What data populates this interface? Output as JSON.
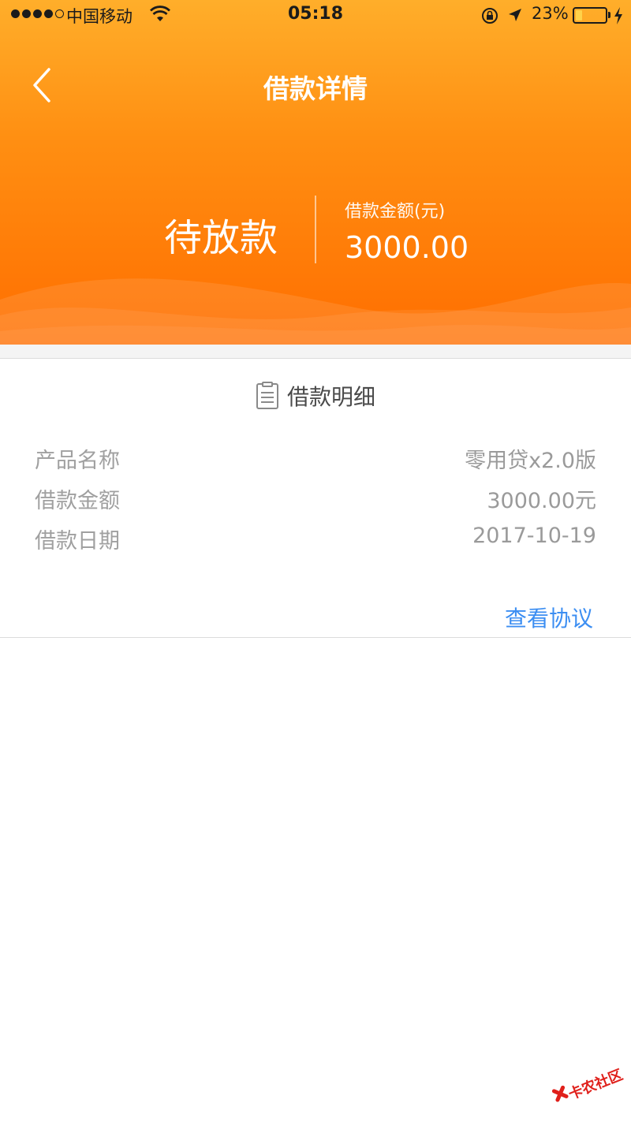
{
  "status_bar": {
    "carrier": "中国移动",
    "time": "05:18",
    "battery": "23%",
    "battery_level": 0.23,
    "icons": [
      "signal-dots-icon",
      "wifi-icon",
      "orientation-lock-icon",
      "location-arrow-icon",
      "battery-icon",
      "charging-bolt-icon"
    ]
  },
  "nav": {
    "title": "借款详情",
    "back_icon": "chevron-left-icon"
  },
  "summary": {
    "status": "待放款",
    "amount_label": "借款金额(元)",
    "amount_value": "3000.00"
  },
  "details": {
    "section_title": "借款明细",
    "section_icon": "document-icon",
    "rows": [
      {
        "label": "产品名称",
        "value": "零用贷x2.0版"
      },
      {
        "label": "借款金额",
        "value": "3000.00元"
      },
      {
        "label": "借款日期",
        "value": "2017-10-19"
      }
    ],
    "link": "查看协议"
  },
  "colors": {
    "header_top": "#FFAE2A",
    "header_bottom": "#FF6E00",
    "link": "#3C8EF2"
  },
  "watermark": {
    "text": "卡农社区"
  }
}
